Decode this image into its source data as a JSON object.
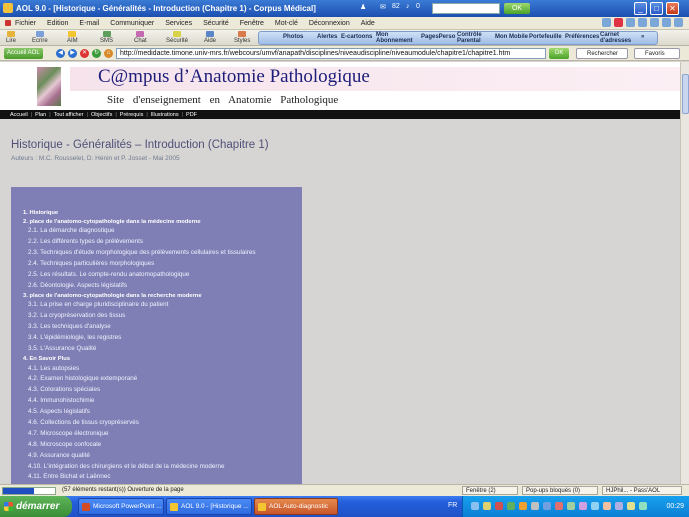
{
  "window": {
    "title": "AOL 9.0 - [Historique - Généralités - Introduction (Chapitre 1) - Corpus Médical]",
    "mail_count": "82",
    "notif_count": "0",
    "ok_label": "OK"
  },
  "menubar": {
    "items": [
      "Fichier",
      "Edition",
      "E-mail",
      "Communiquer",
      "Services",
      "Sécurité",
      "Fenêtre",
      "Mot-clé",
      "Déconnexion",
      "Aide"
    ]
  },
  "toolbar": {
    "left": [
      "Lire",
      "Ecrire",
      "AIM",
      "SMS",
      "Chat",
      "Sécurité",
      "Aide",
      "Styles"
    ],
    "right": [
      "Photos",
      "Alertes",
      "E-cartoons",
      "Mon Abonnement",
      "PagesPerso",
      "Contrôle Parental",
      "Mon Mobile",
      "Portefeuille",
      "Préférences",
      "Carnet d'adresses"
    ]
  },
  "addressbar": {
    "account_label": "Accueil AOL",
    "url": "http://medidacte.timone.univ-mrs.fr/webcours/umvf/anapath/disciplines/niveaudiscipline/niveaumodule/chapitre1/chapitre1.htm",
    "ok_label": "OK",
    "search_label": "Rechercher",
    "favorites_label": "Favoris"
  },
  "site": {
    "title": "C@mpus d’Anatomie Pathologique",
    "subtitle": "Site d'enseignement en Anatomie Pathologique",
    "nav": [
      "Accueil",
      "Plan",
      "Tout afficher",
      "Objectifs",
      "Prérequis",
      "Illustrations",
      "PDF"
    ]
  },
  "page": {
    "heading": "Historique - Généralités – Introduction (Chapitre 1)",
    "authors": "Auteurs : M.C. Rousselet, D. Hénin et P. Josset - Mai 2005"
  },
  "toc": [
    {
      "label": "1. Historique",
      "level": 1
    },
    {
      "label": "2. place de l'anatomo-cytopathologie dans la médecine moderne",
      "level": 1
    },
    {
      "label": "2.1. La démarche diagnostique",
      "level": 2
    },
    {
      "label": "2.2. Les différents types de prélèvements",
      "level": 2
    },
    {
      "label": "2.3. Techniques d'étude morphologique des prélèvements cellulaires et tissulaires",
      "level": 2
    },
    {
      "label": "2.4. Techniques particulières morphologiques",
      "level": 2
    },
    {
      "label": "2.5. Les résultats. Le compte-rendu anatomopathologique",
      "level": 2
    },
    {
      "label": "2.6. Déontologie. Aspects législatifs",
      "level": 2
    },
    {
      "label": "3. place de l'anatomo-cytopathologie dans la recherche moderne",
      "level": 1
    },
    {
      "label": "3.1. La prise en charge pluridisciplinaire du patient",
      "level": 2
    },
    {
      "label": "3.2. La cryopréservation des tissus",
      "level": 2
    },
    {
      "label": "3.3. Les techniques d'analyse",
      "level": 2
    },
    {
      "label": "3.4. L'épidémiologie, les registres",
      "level": 2
    },
    {
      "label": "3.5. L'Assurance Qualité",
      "level": 2
    },
    {
      "label": "4. En Savoir Plus",
      "level": 1
    },
    {
      "label": "4.1. Les autopsies",
      "level": 2
    },
    {
      "label": "4.2. Examen histologique extemporané",
      "level": 2
    },
    {
      "label": "4.3. Colorations spéciales",
      "level": 2
    },
    {
      "label": "4.4. Immunohistochimie",
      "level": 2
    },
    {
      "label": "4.5. Aspects législatifs",
      "level": 2
    },
    {
      "label": "4.6. Collections de tissus cryopréservés",
      "level": 2
    },
    {
      "label": "4.7. Microscope électronique",
      "level": 2
    },
    {
      "label": "4.8. Microscope confocale",
      "level": 2
    },
    {
      "label": "4.9. Assurance qualité",
      "level": 2
    },
    {
      "label": "4.10. L'intégration des chirurgiens et le début de la médecine moderne",
      "level": 2
    },
    {
      "label": "4.11. Entre Bichat et Laënnec",
      "level": 2
    }
  ],
  "statusbar": {
    "progress": 0.6,
    "text": "(57 éléments restant(s)) Ouverture de la page",
    "window_label": "Fenêtre (2)",
    "popups_label": "Pop-ups bloqués (0)",
    "user_label": "HJPhil... - Pass'AOL"
  },
  "taskbar": {
    "start_label": "démarrer",
    "tasks": [
      "Microsoft PowerPoint ...",
      "AOL 9.0 - [Historique ...",
      "AOL Auto-diagnostic"
    ],
    "lang": "FR",
    "clock": "00:29"
  },
  "colors": {
    "toc_bg": "#7f7fb5",
    "heading": "#4f4f78",
    "title_blue": "#1d1d7a",
    "xp_blue": "#245edb"
  }
}
